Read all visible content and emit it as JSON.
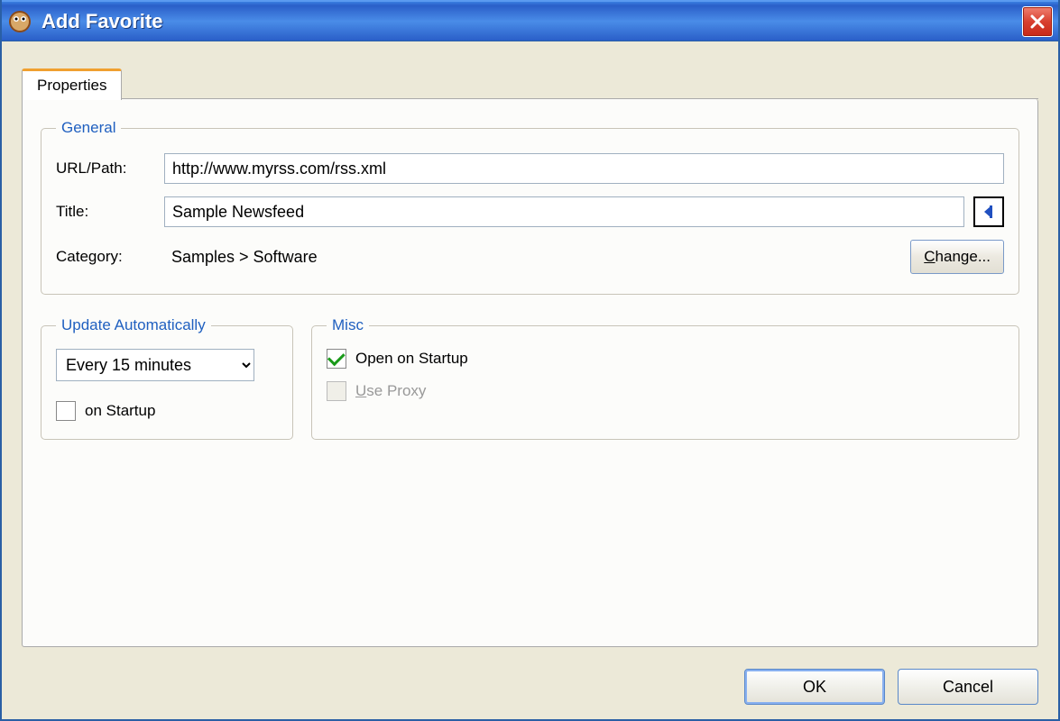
{
  "window": {
    "title": "Add Favorite"
  },
  "tab": {
    "label": "Properties"
  },
  "general": {
    "legend": "General",
    "url_label": "URL/Path:",
    "url_value": "http://www.myrss.com/rss.xml",
    "title_label": "Title:",
    "title_value": "Sample Newsfeed",
    "category_label": "Category:",
    "category_value": "Samples > Software",
    "change_label": "Change..."
  },
  "update": {
    "legend": "Update Automatically",
    "interval_value": "Every 15 minutes",
    "on_startup_label": "on Startup",
    "on_startup_checked": false
  },
  "misc": {
    "legend": "Misc",
    "open_on_startup_label": "Open on Startup",
    "open_on_startup_checked": true,
    "use_proxy_label": "Use Proxy",
    "use_proxy_checked": false,
    "use_proxy_enabled": false
  },
  "buttons": {
    "ok": "OK",
    "cancel": "Cancel"
  }
}
